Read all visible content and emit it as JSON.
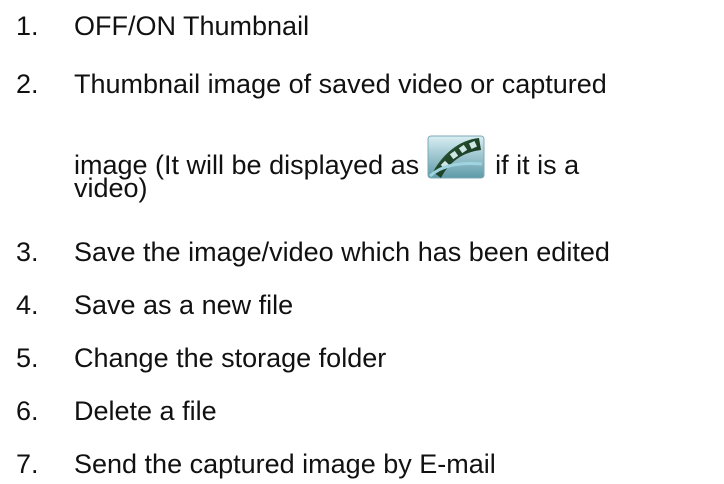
{
  "items": [
    {
      "number": "1.",
      "text": "OFF/ON Thumbnail"
    },
    {
      "number": "2.",
      "text": "Thumbnail image of saved video or captured",
      "line2_before": "image (It will be displayed as",
      "line2_after": "if it is a",
      "line3": "video)",
      "icon": "video-film-icon"
    },
    {
      "number": "3.",
      "text": "Save the image/video which has been edited"
    },
    {
      "number": "4.",
      "text": "Save as a new file"
    },
    {
      "number": "5.",
      "text": "Change the storage folder"
    },
    {
      "number": "6.",
      "text": "Delete a file"
    },
    {
      "number": "7.",
      "text": "Send the captured image by E-mail"
    }
  ],
  "colors": {
    "text": "#111111",
    "background": "#ffffff"
  }
}
